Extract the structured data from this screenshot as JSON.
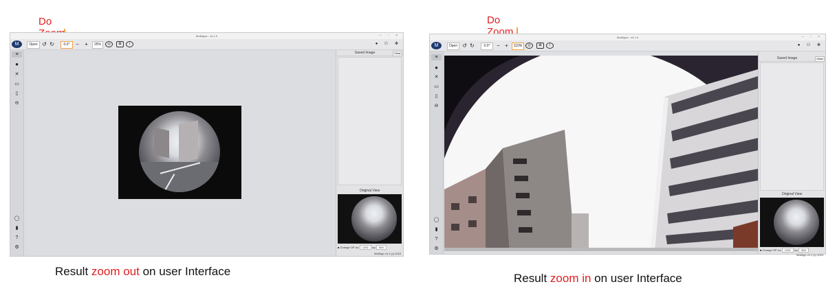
{
  "left": {
    "annotation": "Do Zoom Out",
    "window_title": "MoilApps - v4.1.0",
    "toolbar": {
      "open": "Open",
      "rotation": "0.0°",
      "minus": "−",
      "plus": "+",
      "zoom": "25%"
    },
    "right_panel": {
      "saved_title": "Saved Image",
      "clear": "Clear",
      "original_title": "Original View",
      "change_op": "Change OP",
      "icx_label": "Icx",
      "icx_value": "1292",
      "icy_label": "Icy",
      "icy_value": "959",
      "version": "MoilApp v4.1 (c) 2023"
    },
    "caption": {
      "pre": "Result ",
      "highlight": "zoom out",
      "post": " on user Interface"
    }
  },
  "right": {
    "annotation": "Do Zoom In",
    "window_title": "MoilApps - v4.1.0",
    "toolbar": {
      "open": "Open",
      "rotation": "0.0°",
      "minus": "−",
      "plus": "+",
      "zoom": "110%"
    },
    "right_panel": {
      "saved_title": "Saved Image",
      "clear": "Clear",
      "original_title": "Original View",
      "change_op": "Change OP",
      "icx_label": "Icx",
      "icx_value": "1292",
      "icy_label": "Icy",
      "icy_value": "959",
      "version": "MoilApp v4.1 (c) 2023"
    },
    "caption": {
      "pre": "Result ",
      "highlight": "zoom in",
      "post": " on user Interface"
    }
  },
  "colors": {
    "annotation": "#e02020",
    "highlight_box": "#f0a040"
  },
  "icons": [
    "menu-icon",
    "record-icon",
    "fisheye-icon",
    "panorama-icon",
    "document-icon",
    "minus-circle-icon",
    "refresh-icon",
    "book-icon",
    "help-icon",
    "settings-icon"
  ]
}
